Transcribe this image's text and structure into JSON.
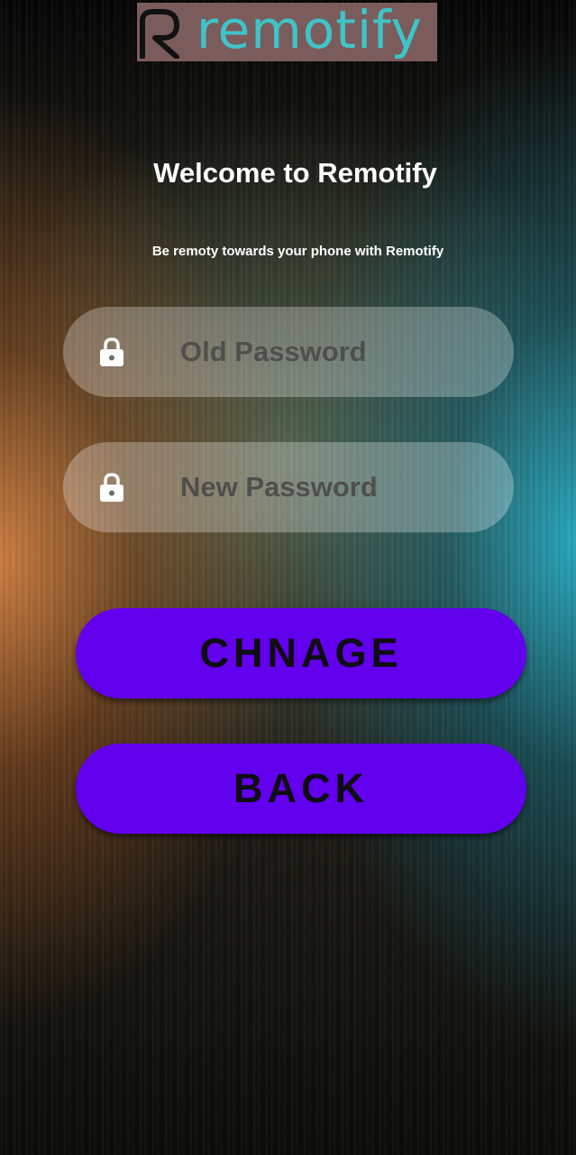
{
  "logo": {
    "wordmark": "remotify",
    "icon": "remotify-r-logo-icon",
    "background_color": "#7b5c5c",
    "text_color": "#3fc4c9"
  },
  "header": {
    "title": "Welcome to Remotify",
    "subtitle": "Be remoty towards your phone with Remotify"
  },
  "form": {
    "old_password": {
      "placeholder": "Old Password",
      "value": "",
      "icon": "lock-icon"
    },
    "new_password": {
      "placeholder": "New Password",
      "value": "",
      "icon": "lock-icon"
    }
  },
  "buttons": {
    "change_label": "CHNAGE",
    "back_label": "BACK",
    "color": "#6200ee"
  }
}
